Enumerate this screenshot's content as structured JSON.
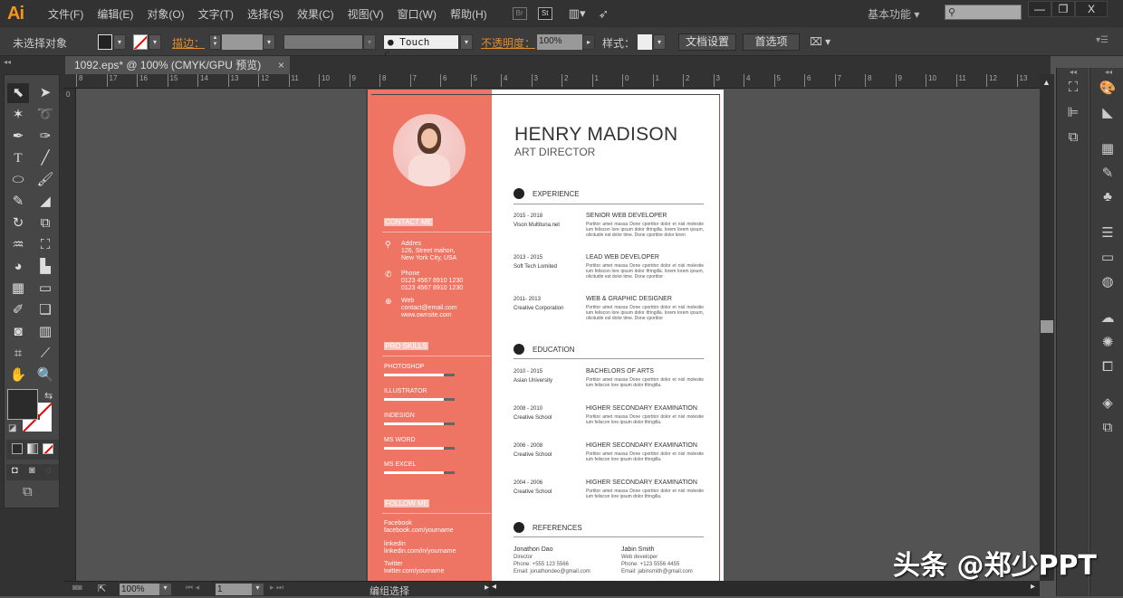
{
  "app": {
    "logo": "Ai",
    "menus": [
      "文件(F)",
      "编辑(E)",
      "对象(O)",
      "文字(T)",
      "选择(S)",
      "效果(C)",
      "视图(V)",
      "窗口(W)",
      "帮助(H)"
    ],
    "bridge": "Br",
    "stock": "St",
    "workspace": "基本功能",
    "workspace_arrow": "▾",
    "search_placeholder": "",
    "win_min": "—",
    "win_restore": "❐",
    "win_close": "X"
  },
  "control": {
    "selection_status": "未选择对象",
    "stroke_label": "描边：",
    "brush_name": "Touch C...",
    "opacity_label": "不透明度：",
    "opacity_value": "100%",
    "style_label": "样式：",
    "doc_setup": "文档设置",
    "prefs": "首选项"
  },
  "document": {
    "tab_title": "1092.eps* @ 100% (CMYK/GPU 预览)",
    "tab_close": "×",
    "ruler_ticks": [
      "8",
      "17",
      "16",
      "15",
      "14",
      "13",
      "12",
      "11",
      "10",
      "9",
      "8",
      "7",
      "6",
      "5",
      "4",
      "3",
      "2",
      "1",
      "0",
      "1",
      "2",
      "3",
      "4",
      "5",
      "6",
      "7",
      "8",
      "9",
      "10",
      "11",
      "12",
      "13"
    ]
  },
  "status": {
    "zoom": "100%",
    "page": "1",
    "tool": "编组选择"
  },
  "resume": {
    "name": "HENRY MADISON",
    "title": "ART DIRECTOR",
    "contact_heading": "CONTACT ME",
    "contacts": [
      {
        "label": "Addres",
        "lines": [
          "126, Street mahon,",
          "New York City, USA"
        ],
        "icon": "location-pin-icon"
      },
      {
        "label": "Phone",
        "lines": [
          "0123 4567 8910 1230",
          "0123 4567 8910 1230"
        ],
        "icon": "phone-icon"
      },
      {
        "label": "Web",
        "lines": [
          "contact@email.com",
          "www.ownsite.com"
        ],
        "icon": "globe-icon"
      }
    ],
    "skills_heading": "PRO SKILLS",
    "skills": [
      {
        "name": "PHOTOSHOP",
        "level": 0.85
      },
      {
        "name": "ILLUSTRATOR",
        "level": 0.85
      },
      {
        "name": "INDESIGN",
        "level": 0.85
      },
      {
        "name": "MS WORD",
        "level": 0.85
      },
      {
        "name": "MS EXCEL",
        "level": 0.85
      }
    ],
    "follow_heading": "FOLLOW ME",
    "follow": [
      {
        "label": "Facebook",
        "value": "facebook.com/yourname"
      },
      {
        "label": "linkedin",
        "value": "linkedin.com/in/yourname"
      },
      {
        "label": "Twitter",
        "value": "twitter.com/yourname"
      }
    ],
    "experience_heading": "EXPERIENCE",
    "experience": [
      {
        "years": "2015 - 2018",
        "org": "Vison Multituna.net",
        "role": "SENIOR WEB DEVELOPER",
        "desc": "Portitor amet massa Done cportitor dolor et nisl molestie ium feliscon lore ipsum dolor tfringilla. lorem lorem ipsum, olicitudin est dolor time. Done cportitor dolor kiren"
      },
      {
        "years": "2013 - 2015",
        "org": "Soft Tech Lomited",
        "role": "LEAD WEB DEVELOPER",
        "desc": "Portitor amet massa Done cportitor dolor et nisl molestie ium feliscon lore ipsum dolor tfringilla. lorem lorem ipsum, olicitudin est dolor time. Done cportitor"
      },
      {
        "years": "2011- 2013",
        "org": "Creative Corporation",
        "role": "WEB & GRAPHIC DESIGNER",
        "desc": "Portitor amet massa Done cportitor dolor et nisl molestie ium feliscon lore ipsum dolor tfringilla. lorem lorem ipsum, olicitudin est dolor time. Done cportitor"
      }
    ],
    "education_heading": "EDUCATION",
    "education": [
      {
        "years": "2010 - 2015",
        "org": "Asian University",
        "degree": "BACHELORS OF ARTS",
        "desc": "Portitor amet massa Done cportitor dolor et nisl molestie ium feliscon lore ipsum dolor tfringilla."
      },
      {
        "years": "2008 - 2010",
        "org": "Creative School",
        "degree": "HIGHER SECONDARY EXAMINATION",
        "desc": "Portitor amet massa Done cportitor dolor et nisl molestie ium feliscon lore ipsum dolor tfringilla."
      },
      {
        "years": "2006 - 2008",
        "org": "Creative School",
        "degree": "HIGHER SECONDARY EXAMINATION",
        "desc": "Portitor amet massa Done cportitor dolor et nisl molestie ium feliscon lore ipsum dolor tfringilla."
      },
      {
        "years": "2004 - 2006",
        "org": "Creative School",
        "degree": "HIGHER SECONDARY EXAMINATION",
        "desc": "Portitor amet massa Done cportitor dolor et nisl molestie ium feliscon lore ipsum dolor tfringilla."
      }
    ],
    "references_heading": "REFERENCES",
    "references": [
      {
        "name": "Jonathon Dao",
        "role": "Director",
        "phone": "Phone: +555 123 5566",
        "email": "Email: jonathondeo@gmail.com"
      },
      {
        "name": "Jabin Smith",
        "role": "Web developer",
        "phone": "Phone: +123 5556 4455",
        "email": "Email: jabinsmith@gmail.com"
      }
    ]
  },
  "watermark": "头条 @郑少PPT",
  "colors": {
    "accent": "#ee7463",
    "chrome": "#323232",
    "canvas": "#535353"
  }
}
